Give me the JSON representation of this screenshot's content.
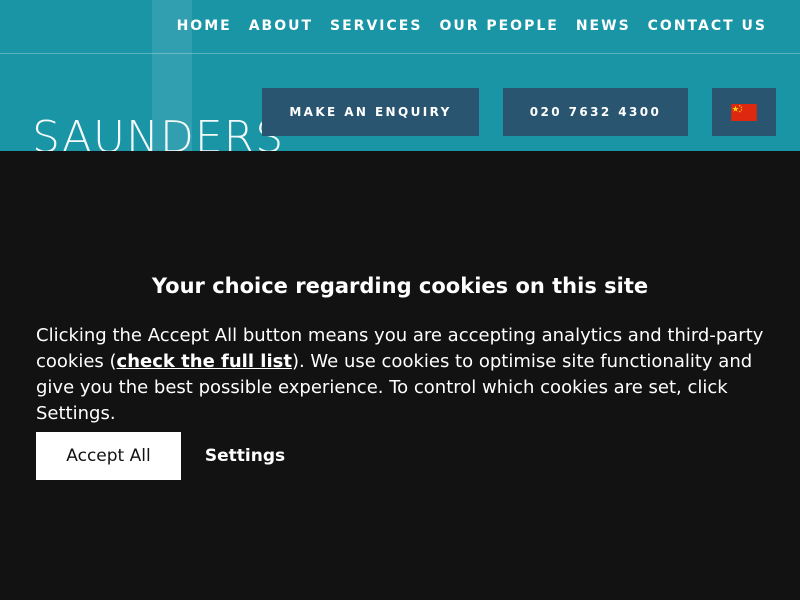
{
  "header": {
    "nav": [
      {
        "label": "HOME"
      },
      {
        "label": "ABOUT"
      },
      {
        "label": "SERVICES"
      },
      {
        "label": "OUR PEOPLE"
      },
      {
        "label": "NEWS"
      },
      {
        "label": "CONTACT US"
      }
    ],
    "logo_text": "SAUNDERS",
    "enquiry_label": "MAKE AN ENQUIRY",
    "phone_label": "020 7632 4300",
    "language_icon": "china-flag-icon"
  },
  "cookie_banner": {
    "title": "Your choice regarding cookies on this site",
    "body_before_link": "Clicking the Accept All button means you are accepting analytics and third-party cookies (",
    "link_text": "check the full list",
    "body_after_link": "). We use cookies to optimise site functionality and give you the best possible experience. To control which cookies are set, click Settings.",
    "accept_label": "Accept All",
    "settings_label": "Settings"
  },
  "colors": {
    "header_bg": "#1a95a6",
    "header_button_bg": "#2a5570",
    "overlay_bg": "#121212",
    "flag_red": "#de2910",
    "flag_yellow": "#ffde00"
  }
}
